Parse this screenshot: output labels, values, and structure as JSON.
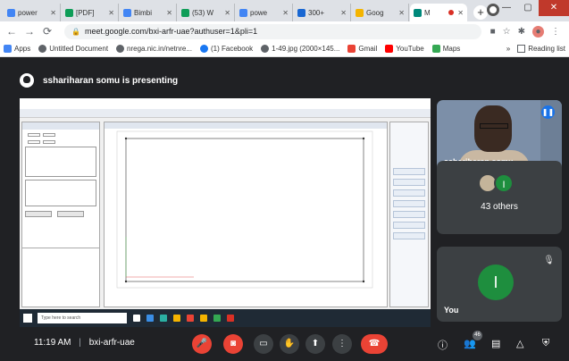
{
  "browser": {
    "tabs": [
      {
        "label": "power",
        "color": "#4285f4"
      },
      {
        "label": "[PDF]",
        "color": "#0f9d58"
      },
      {
        "label": "Bimbi",
        "color": "#4285f4"
      },
      {
        "label": "(53) W",
        "color": "#0f9d58"
      },
      {
        "label": "powe",
        "color": "#4285f4"
      },
      {
        "label": "300+",
        "color": "#1967d2"
      },
      {
        "label": "Goog",
        "color": "#f4b400"
      },
      {
        "label": "M",
        "color": "#00897b"
      }
    ],
    "new_tab": "+",
    "url": "meet.google.com/bxi-arfr-uae?authuser=1&pli=1",
    "bookmarks": [
      {
        "label": "Apps",
        "color": "#4285f4"
      },
      {
        "label": "Untitled Document",
        "color": "#5f6368"
      },
      {
        "label": "nrega.nic.in/netnre...",
        "color": "#5f6368"
      },
      {
        "label": "(1) Facebook",
        "color": "#1877f2"
      },
      {
        "label": "1-49.jpg (2000×145...",
        "color": "#5f6368"
      },
      {
        "label": "Gmail",
        "color": "#ea4335"
      },
      {
        "label": "YouTube",
        "color": "#ff0000"
      },
      {
        "label": "Maps",
        "color": "#34a853"
      }
    ],
    "overflow": "»",
    "reading_list": "Reading list"
  },
  "meet": {
    "presenting_text": "sshariharan somu is presenting",
    "shared_screen": {
      "taskbar_search": "Type here to search"
    },
    "participants": {
      "presenter_name": "sshariharan somu",
      "others_label": "43 others",
      "others_initial": "I",
      "you_label": "You",
      "you_initial": "I"
    },
    "bottom": {
      "time": "11:19 AM",
      "separator": "|",
      "meeting_code": "bxi-arfr-uae",
      "people_count": "46"
    }
  }
}
